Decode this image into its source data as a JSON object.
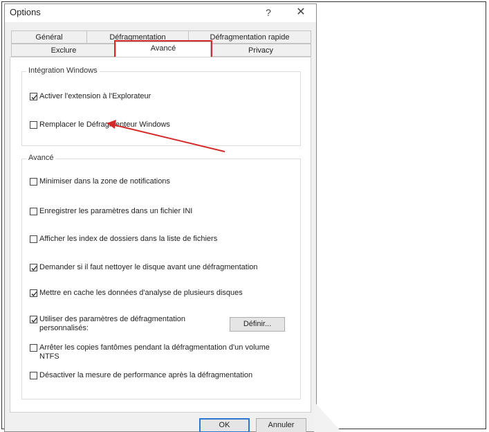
{
  "window": {
    "title": "Options",
    "help_glyph": "?",
    "close_glyph": "✕"
  },
  "tabs_row_top": [
    {
      "label": "Général"
    },
    {
      "label": "Défragmentation"
    },
    {
      "label": "Défragmentation rapide"
    }
  ],
  "tabs_row_bottom": [
    {
      "label": "Exclure"
    },
    {
      "label": "Avancé",
      "active": true
    },
    {
      "label": "Privacy"
    }
  ],
  "integration_group": {
    "title": "Intégration Windows",
    "options": [
      {
        "label": "Activer l'extension à l'Explorateur",
        "checked": true
      },
      {
        "label": "Remplacer le Défragmenteur Windows",
        "checked": false
      }
    ]
  },
  "advanced_group": {
    "title": "Avancé",
    "options": [
      {
        "label": "Minimiser dans la zone de notifications",
        "checked": false
      },
      {
        "label": "Enregistrer les paramètres dans un fichier INI",
        "checked": false
      },
      {
        "label": "Afficher les index de dossiers dans la liste de fichiers",
        "checked": false
      },
      {
        "label": "Demander si il faut nettoyer le disque avant une défragmentation",
        "checked": true
      },
      {
        "label": "Mettre en cache les données d'analyse de plusieurs disques",
        "checked": true
      },
      {
        "label": "Utiliser des paramètres de défragmentation personnalisés:",
        "checked": true
      },
      {
        "label": "Arrêter les copies fantômes pendant la défragmentation d'un volume NTFS",
        "checked": false
      },
      {
        "label": "Désactiver la mesure de performance après la défragmentation",
        "checked": false
      }
    ],
    "define_button": "Définir..."
  },
  "footer": {
    "ok_label": "OK",
    "cancel_label": "Annuler"
  },
  "colors": {
    "annotation_red": "#d42a2a",
    "ok_border": "#2a78d4"
  }
}
